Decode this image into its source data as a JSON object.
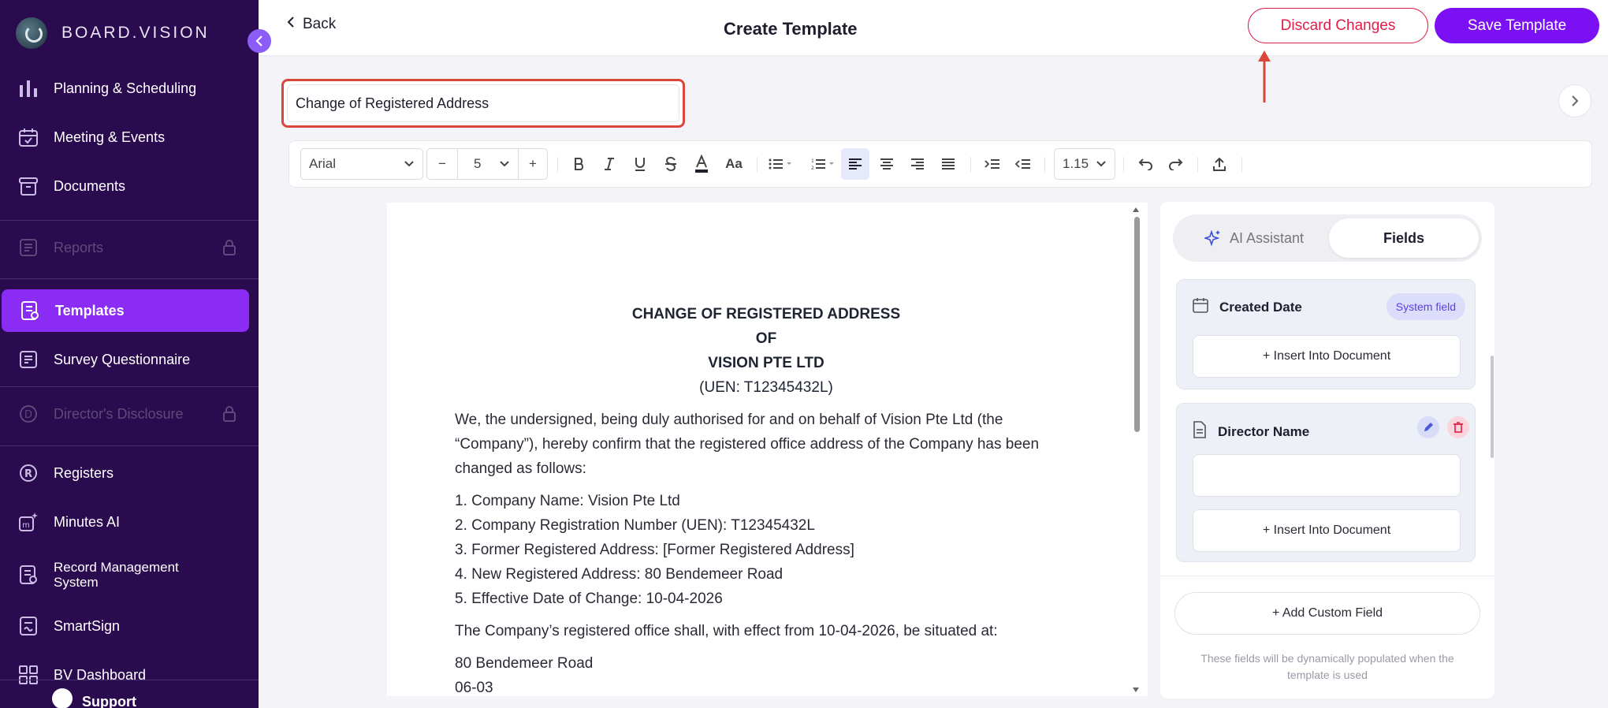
{
  "brand": {
    "name": "BOARD.VISION"
  },
  "sidebar": {
    "items": [
      {
        "label": "Planning & Scheduling",
        "icon": "bar-chart-icon",
        "state": "normal"
      },
      {
        "label": "Meeting & Events",
        "icon": "calendar-icon",
        "state": "normal"
      },
      {
        "label": "Documents",
        "icon": "archive-icon",
        "state": "normal"
      },
      {
        "label": "Reports",
        "icon": "report-icon",
        "state": "disabled"
      },
      {
        "label": "Templates",
        "icon": "template-icon",
        "state": "active"
      },
      {
        "label": "Survey Questionnaire",
        "icon": "survey-icon",
        "state": "normal"
      },
      {
        "label": "Director's Disclosure",
        "icon": "disclosure-icon",
        "state": "disabled"
      },
      {
        "label": "Registers",
        "icon": "registered-icon",
        "state": "normal"
      },
      {
        "label": "Minutes AI",
        "icon": "minutes-ai-icon",
        "state": "normal"
      },
      {
        "label": "Record Management System",
        "icon": "record-icon",
        "state": "normal"
      },
      {
        "label": "SmartSign",
        "icon": "sign-icon",
        "state": "normal"
      },
      {
        "label": "BV Dashboard",
        "icon": "dashboard-icon",
        "state": "normal"
      },
      {
        "label": "Support",
        "icon": "support-icon",
        "state": "normal"
      }
    ]
  },
  "header": {
    "back_label": "Back",
    "title": "Create Template",
    "discard_label": "Discard Changes",
    "save_label": "Save Template"
  },
  "template_name": {
    "value": "Change of Registered Address"
  },
  "toolbar": {
    "font_family": "Arial",
    "font_size": "5",
    "line_height": "1.15",
    "minus": "−",
    "plus": "+",
    "case_label": "Aa"
  },
  "document": {
    "heading": [
      "CHANGE OF REGISTERED ADDRESS",
      "OF",
      "VISION PTE LTD"
    ],
    "uen": "(UEN: T12345432L)",
    "intro": "We, the undersigned, being duly authorised for and on behalf of Vision Pte Ltd (the “Company”), hereby confirm that the registered office address of the Company has been changed as follows:",
    "list": [
      "1. Company Name: Vision Pte Ltd",
      "2. Company Registration Number (UEN): T12345432L",
      "3. Former Registered Address: [Former Registered Address]",
      "4. New Registered Address: 80 Bendemeer Road",
      "5. Effective Date of Change: 10-04-2026"
    ],
    "statement": "The Company’s registered office shall, with effect from 10-04-2026, be situated at:",
    "address": [
      "80 Bendemeer Road",
      "06-03"
    ]
  },
  "panel": {
    "tab_ai": "AI Assistant",
    "tab_fields": "Fields",
    "fields": [
      {
        "label": "Created Date",
        "badge": "System field",
        "insert_label": "+ Insert Into Document"
      },
      {
        "label": "Director Name",
        "insert_label": "+ Insert Into Document",
        "value": ""
      }
    ],
    "add_custom_label": "+ Add Custom Field",
    "hint": "These fields will be dynamically populated when the template is used"
  },
  "colors": {
    "sidebar_bg": "#2b0b4f",
    "accent": "#7c10f5",
    "danger": "#e11d48",
    "highlight_box": "#d9473b"
  }
}
